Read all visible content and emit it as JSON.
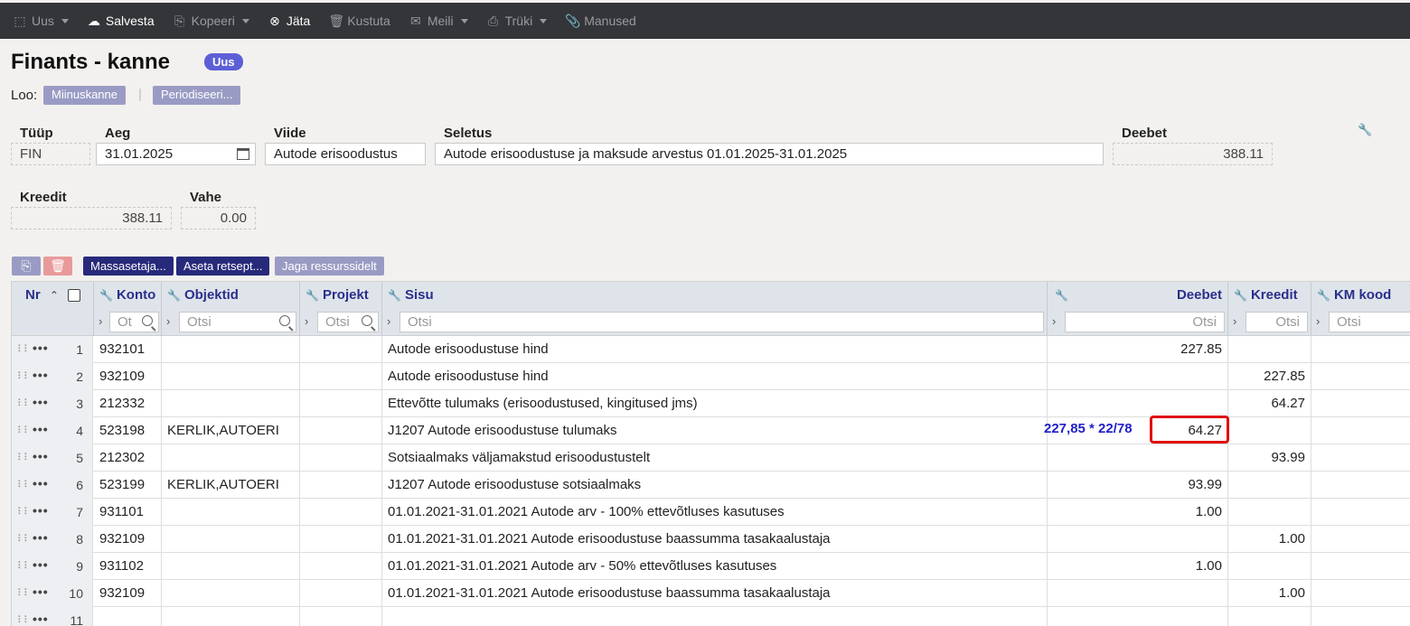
{
  "toolbar": {
    "items": [
      {
        "label": "Uus",
        "icon": "new-doc-icon",
        "caret": true,
        "active": false
      },
      {
        "label": "Salvesta",
        "icon": "cloud-upload-icon",
        "caret": false,
        "active": true
      },
      {
        "label": "Kopeeri",
        "icon": "copy-icon",
        "caret": true,
        "active": false
      },
      {
        "label": "Jäta",
        "icon": "close-circle-icon",
        "caret": false,
        "active": true
      },
      {
        "label": "Kustuta",
        "icon": "trash-icon",
        "caret": false,
        "active": false
      },
      {
        "label": "Meili",
        "icon": "mail-icon",
        "caret": true,
        "active": false
      },
      {
        "label": "Trüki",
        "icon": "printer-icon",
        "caret": true,
        "active": false
      },
      {
        "label": "Manused",
        "icon": "paperclip-icon",
        "caret": false,
        "active": false
      }
    ]
  },
  "header": {
    "title": "Finants - kanne",
    "badge": "Uus",
    "create_label": "Loo:",
    "create_buttons": [
      "Miinuskanne",
      "Periodiseeri..."
    ]
  },
  "form": {
    "tyyp": {
      "label": "Tüüp",
      "value": "FIN"
    },
    "aeg": {
      "label": "Aeg",
      "value": "31.01.2025"
    },
    "viide": {
      "label": "Viide",
      "value": "Autode erisoodustus"
    },
    "seletus": {
      "label": "Seletus",
      "value": "Autode erisoodustuse ja maksude arvestus 01.01.2025-31.01.2025"
    },
    "deebet": {
      "label": "Deebet",
      "value": "388.11"
    },
    "kreedit": {
      "label": "Kreedit",
      "value": "388.11"
    },
    "vahe": {
      "label": "Vahe",
      "value": "0.00"
    }
  },
  "actions": {
    "massasetaja": "Massasetaja...",
    "aseta_retsept": "Aseta retsept...",
    "jaga": "Jaga ressurssidelt"
  },
  "grid": {
    "headers": {
      "nr": "Nr",
      "konto": "Konto",
      "objektid": "Objektid",
      "projekt": "Projekt",
      "sisu": "Sisu",
      "deebet": "Deebet",
      "kreedit": "Kreedit",
      "km_kood": "KM kood"
    },
    "filter_placeholders": {
      "konto": "Ot",
      "objektid": "Otsi",
      "projekt": "Otsi",
      "sisu": "Otsi",
      "deebet": "Otsi",
      "kreedit": "Otsi",
      "km_kood": "Otsi"
    },
    "rows": [
      {
        "nr": "1",
        "konto": "932101",
        "objektid": "",
        "projekt": "",
        "sisu": "Autode erisoodustuse hind",
        "deebet": "227.85",
        "kreedit": "",
        "km": ""
      },
      {
        "nr": "2",
        "konto": "932109",
        "objektid": "",
        "projekt": "",
        "sisu": "Autode erisoodustuse hind",
        "deebet": "",
        "kreedit": "227.85",
        "km": ""
      },
      {
        "nr": "3",
        "konto": "212332",
        "objektid": "",
        "projekt": "",
        "sisu": "Ettevõtte tulumaks (erisoodustused, kingitused jms)",
        "deebet": "",
        "kreedit": "64.27",
        "km": ""
      },
      {
        "nr": "4",
        "konto": "523198",
        "objektid": "KERLIK,AUTOERI",
        "projekt": "",
        "sisu": "J1207 Autode erisoodustuse tulumaks",
        "deebet": "64.27",
        "kreedit": "",
        "km": ""
      },
      {
        "nr": "5",
        "konto": "212302",
        "objektid": "",
        "projekt": "",
        "sisu": "Sotsiaalmaks väljamakstud erisoodustustelt",
        "deebet": "",
        "kreedit": "93.99",
        "km": ""
      },
      {
        "nr": "6",
        "konto": "523199",
        "objektid": "KERLIK,AUTOERI",
        "projekt": "",
        "sisu": "J1207 Autode erisoodustuse sotsiaalmaks",
        "deebet": "93.99",
        "kreedit": "",
        "km": ""
      },
      {
        "nr": "7",
        "konto": "931101",
        "objektid": "",
        "projekt": "",
        "sisu": "01.01.2021-31.01.2021 Autode arv - 100% ettevõtluses kasutuses",
        "deebet": "1.00",
        "kreedit": "",
        "km": ""
      },
      {
        "nr": "8",
        "konto": "932109",
        "objektid": "",
        "projekt": "",
        "sisu": "01.01.2021-31.01.2021 Autode erisoodustuse baassumma tasakaalustaja",
        "deebet": "",
        "kreedit": "1.00",
        "km": ""
      },
      {
        "nr": "9",
        "konto": "931102",
        "objektid": "",
        "projekt": "",
        "sisu": "01.01.2021-31.01.2021 Autode arv - 50% ettevõtluses kasutuses",
        "deebet": "1.00",
        "kreedit": "",
        "km": ""
      },
      {
        "nr": "10",
        "konto": "932109",
        "objektid": "",
        "projekt": "",
        "sisu": "01.01.2021-31.01.2021 Autode erisoodustuse baassumma tasakaalustaja",
        "deebet": "",
        "kreedit": "1.00",
        "km": ""
      },
      {
        "nr": "11",
        "konto": "",
        "objektid": "",
        "projekt": "",
        "sisu": "",
        "deebet": "",
        "kreedit": "",
        "km": ""
      }
    ]
  },
  "annotation": {
    "text": "227,85 * 22/78",
    "color": "#2020c8",
    "highlight_color": "#e01010"
  },
  "colors": {
    "toolbar_bg": "#343539",
    "accent_dark": "#272a7a",
    "badge": "#5c5fd6",
    "header_text": "#2a2f8c"
  }
}
